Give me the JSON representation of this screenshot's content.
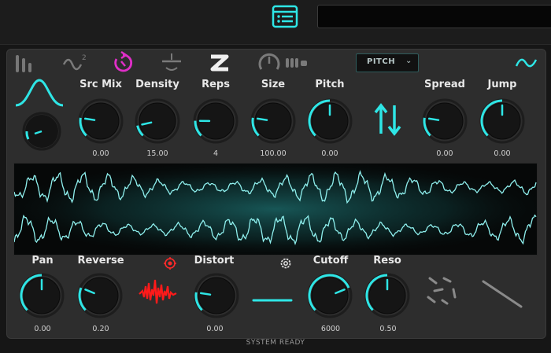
{
  "toolbar": {
    "menu_icon": "list-menu-icon",
    "search_value": ""
  },
  "header": {
    "mode_icons": [
      "bars-icon",
      "sine-squared-icon",
      "rotate-icon",
      "slice-icon",
      "s-curve-icon",
      "dial-icon",
      "bars-small-icon"
    ],
    "mode_dropdown": {
      "label": "PITCH",
      "options_icon": "chevron-down-icon"
    },
    "wave_shape_icon": "sine-wave-icon"
  },
  "row1": {
    "envelope_icon": "bell-curve-icon",
    "knobs": [
      {
        "label": "Src Mix",
        "value": "0.00",
        "level": 0.2
      },
      {
        "label": "Density",
        "value": "15.00",
        "level": 0.12
      },
      {
        "label": "Reps",
        "value": "4",
        "level": 0.17
      },
      {
        "label": "Size",
        "value": "100.00",
        "level": 0.2
      },
      {
        "label": "Pitch",
        "value": "0.00",
        "level": 0.5
      },
      {
        "label": "Spread",
        "value": "0.00",
        "level": 0.2
      },
      {
        "label": "Jump",
        "value": "0.00",
        "level": 0.5
      }
    ],
    "swap_icon": "swap-arrows-icon"
  },
  "row2": {
    "knobs": [
      {
        "label": "Pan",
        "value": "0.00",
        "level": 0.5
      },
      {
        "label": "Reverse",
        "value": "0.20",
        "level": 0.25
      },
      {
        "label": "Distort",
        "value": "0.00",
        "level": 0.2
      },
      {
        "label": "Cutoff",
        "value": "6000",
        "level": 0.75
      },
      {
        "label": "Reso",
        "value": "0.50",
        "level": 0.5
      }
    ],
    "target_icon": "target-icon",
    "settings_icon": "gear-icon",
    "distort_icon": "noise-waveform-icon",
    "line_icon": "flat-line-icon",
    "scatter_icon": "scatter-icon",
    "diagonal_icon": "diagonal-line-icon"
  },
  "status": "SYSTEM READY",
  "colors": {
    "accent": "#2ee6e6",
    "magenta": "#e02ec8",
    "red": "#ff1a1a"
  }
}
